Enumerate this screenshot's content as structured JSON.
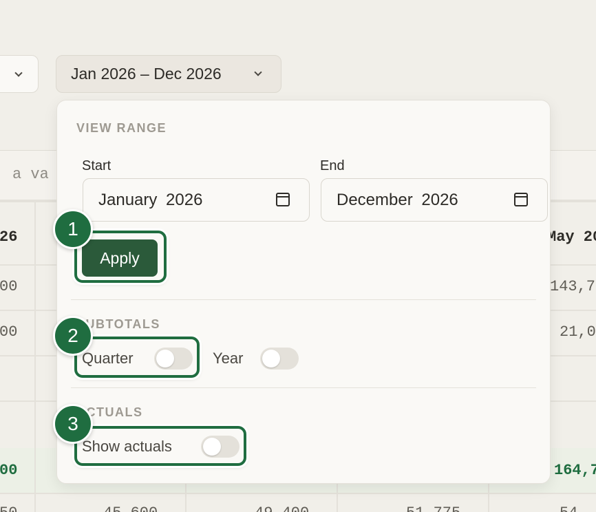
{
  "header": {
    "range_label": "Jan 2026 – Dec 2026"
  },
  "filter": {
    "placeholder_fragment": "a va"
  },
  "table": {
    "header_cells": [
      "26",
      "May 20"
    ],
    "rows": [
      [
        "00",
        "143,7"
      ],
      [
        "00",
        "21,0"
      ]
    ],
    "total_row": [
      "00",
      "164,7"
    ],
    "bottom_row": [
      "50",
      "45,600",
      "49,400",
      "51,775",
      "54,"
    ]
  },
  "panel": {
    "view_range_title": "VIEW RANGE",
    "start_label": "Start",
    "start_value": "January 2026",
    "end_label": "End",
    "end_value": "December 2026",
    "apply_label": "Apply",
    "subtotals_title": "SUBTOTALS",
    "quarter_label": "Quarter",
    "year_label": "Year",
    "actuals_title": "ACTUALS",
    "show_actuals_label": "Show actuals",
    "toggles": {
      "quarter": false,
      "year": false,
      "show_actuals": false
    }
  },
  "annotations": [
    "1",
    "2",
    "3"
  ],
  "colors": {
    "accent": "#1f6d40",
    "apply_button": "#2b5a3a"
  }
}
